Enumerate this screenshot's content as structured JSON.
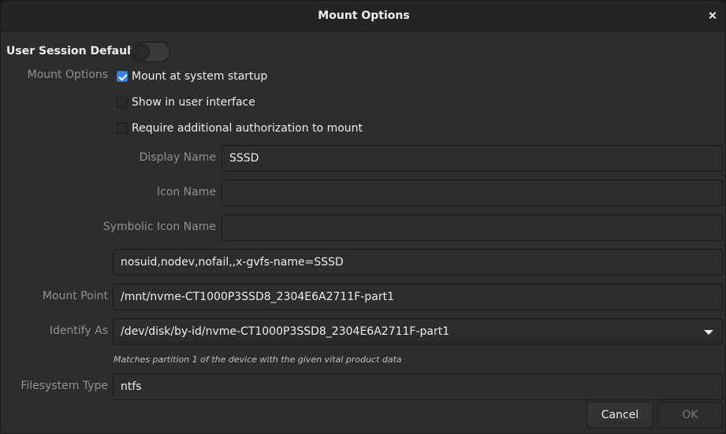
{
  "window": {
    "title": "Mount Options"
  },
  "user_session": {
    "label": "User Session Defaults",
    "enabled": false
  },
  "mount_options": {
    "label": "Mount Options",
    "options": [
      {
        "label": "Mount at system startup",
        "checked": true
      },
      {
        "label": "Show in user interface",
        "checked": false
      },
      {
        "label": "Require additional authorization to mount",
        "checked": false
      }
    ]
  },
  "fields": {
    "display_name": {
      "label": "Display Name",
      "value": "SSSD"
    },
    "icon_name": {
      "label": "Icon Name",
      "value": ""
    },
    "symbolic_icon_name": {
      "label": "Symbolic Icon Name",
      "value": ""
    },
    "options_string": {
      "value": "nosuid,nodev,nofail,,x-gvfs-name=SSSD"
    },
    "mount_point": {
      "label": "Mount Point",
      "value": "/mnt/nvme-CT1000P3SSD8_2304E6A2711F-part1"
    },
    "identify_as": {
      "label": "Identify As",
      "selected": "/dev/disk/by-id/nvme-CT1000P3SSD8_2304E6A2711F-part1",
      "hint": "Matches partition 1 of the device with the given vital product data"
    },
    "filesystem_type": {
      "label": "Filesystem Type",
      "value": "ntfs"
    }
  },
  "buttons": {
    "cancel": "Cancel",
    "ok": "OK"
  },
  "colors": {
    "accent": "#3584e4",
    "background": "#2d2d2d",
    "titlebar": "#242424"
  }
}
